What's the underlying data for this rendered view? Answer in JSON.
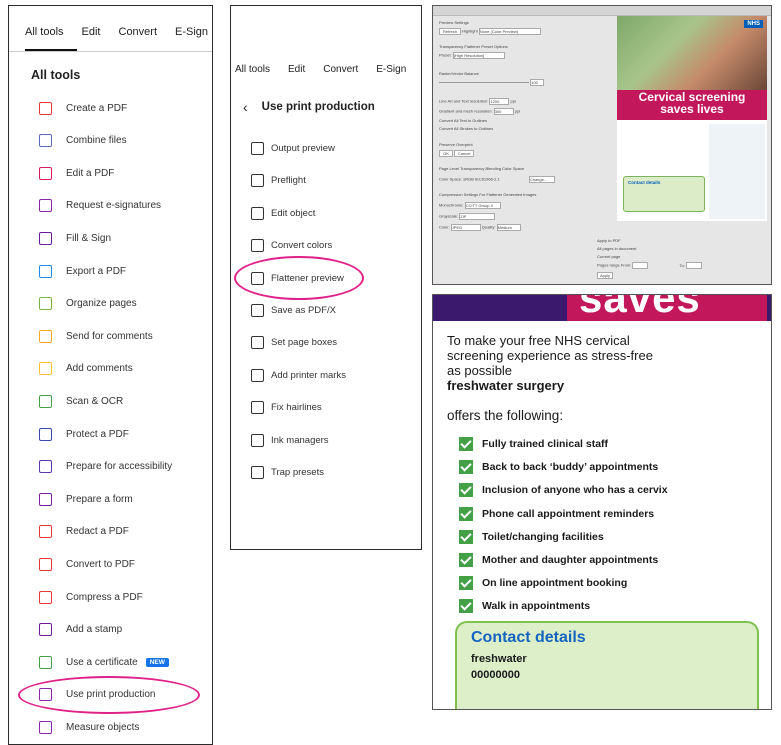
{
  "left_panel": {
    "tabs": [
      "All tools",
      "Edit",
      "Convert",
      "E-Sign"
    ],
    "title": "All tools",
    "tools": [
      {
        "label": "Create a PDF",
        "icon": "pdf-create-icon",
        "color": "#e53935"
      },
      {
        "label": "Combine files",
        "icon": "combine-files-icon",
        "color": "#5c6bc0"
      },
      {
        "label": "Edit a PDF",
        "icon": "edit-pdf-icon",
        "color": "#d81b60"
      },
      {
        "label": "Request e-signatures",
        "icon": "request-signature-icon",
        "color": "#8e24aa"
      },
      {
        "label": "Fill & Sign",
        "icon": "fill-sign-icon",
        "color": "#6a1b9a"
      },
      {
        "label": "Export a PDF",
        "icon": "export-pdf-icon",
        "color": "#1e88e5"
      },
      {
        "label": "Organize pages",
        "icon": "organize-pages-icon",
        "color": "#7cb342"
      },
      {
        "label": "Send for comments",
        "icon": "send-comments-icon",
        "color": "#f9a825"
      },
      {
        "label": "Add comments",
        "icon": "add-comments-icon",
        "color": "#fbc02d"
      },
      {
        "label": "Scan & OCR",
        "icon": "scan-ocr-icon",
        "color": "#43a047"
      },
      {
        "label": "Protect a PDF",
        "icon": "protect-pdf-icon",
        "color": "#3949ab"
      },
      {
        "label": "Prepare for accessibility",
        "icon": "accessibility-icon",
        "color": "#5e35b1"
      },
      {
        "label": "Prepare a form",
        "icon": "prepare-form-icon",
        "color": "#7b1fa2"
      },
      {
        "label": "Redact a PDF",
        "icon": "redact-icon",
        "color": "#e53935"
      },
      {
        "label": "Convert to PDF",
        "icon": "convert-pdf-icon",
        "color": "#e53935"
      },
      {
        "label": "Compress a PDF",
        "icon": "compress-pdf-icon",
        "color": "#e53935"
      },
      {
        "label": "Add a stamp",
        "icon": "stamp-icon",
        "color": "#6a1b9a"
      },
      {
        "label": "Use a certificate",
        "icon": "certificate-icon",
        "color": "#43a047",
        "badge": "NEW"
      },
      {
        "label": "Use print production",
        "icon": "print-production-icon",
        "color": "#8e24aa"
      },
      {
        "label": "Measure objects",
        "icon": "measure-icon",
        "color": "#8e24aa"
      }
    ]
  },
  "mid_panel": {
    "tabs": [
      "All tools",
      "Edit",
      "Convert",
      "E-Sign"
    ],
    "title": "Use print production",
    "items": [
      {
        "label": "Output preview",
        "icon": "output-preview-icon"
      },
      {
        "label": "Preflight",
        "icon": "preflight-icon"
      },
      {
        "label": "Edit object",
        "icon": "edit-object-icon"
      },
      {
        "label": "Convert colors",
        "icon": "convert-colors-icon"
      },
      {
        "label": "Flattener preview",
        "icon": "flattener-preview-icon"
      },
      {
        "label": "Save as PDF/X",
        "icon": "save-pdfx-icon"
      },
      {
        "label": "Set page boxes",
        "icon": "page-boxes-icon"
      },
      {
        "label": "Add printer marks",
        "icon": "printer-marks-icon"
      },
      {
        "label": "Fix hairlines",
        "icon": "hairlines-icon"
      },
      {
        "label": "Ink managers",
        "icon": "ink-managers-icon"
      },
      {
        "label": "Trap presets",
        "icon": "trap-presets-icon"
      }
    ]
  },
  "flattener_dialog": {
    "section_preview": "Preview Settings",
    "refresh": "Refresh",
    "highlight": "Highlight",
    "highlight_value": "None (Color Preview)",
    "section_preset": "Transparency Flattener Preset Options",
    "preset_label": "Preset:",
    "preset_value": "[High Resolution]",
    "balance_label": "Raster/Vector Balance",
    "balance_value": "100",
    "line_art_label": "Line Art and Text resolution:",
    "line_art_value": "1200",
    "gradient_label": "Gradient and mesh resolution:",
    "gradient_value": "300",
    "ppi": "ppi",
    "opt1": "Convert All Text to Outlines",
    "opt2": "Convert All Strokes to Outlines",
    "opt3": "Preserve Overprint",
    "ok": "OK",
    "cancel": "Cancel",
    "section_color": "Page Level Transparency Blending Color Space",
    "color_space_label": "Color Space:",
    "color_space_value": "sRGB IEC61966-2.1",
    "change": "Change...",
    "section_compress": "Compression Settings For Flattener Generated Images",
    "mono_label": "Monochrome:",
    "mono_value": "CCITT Group 4",
    "gray_label": "Grayscale:",
    "gray_value": "ZIP",
    "color_label": "Color:",
    "color_value": "JPEG",
    "quality_label": "Quality:",
    "quality_value": "Medium",
    "apply_title": "Apply to PDF",
    "apply_opt1": "All pages in document",
    "apply_opt2": "Current page",
    "apply_opt3": "Pages range",
    "from": "From:",
    "to": "To:",
    "apply_btn": "Apply"
  },
  "poster_thumb": {
    "nhs": "NHS",
    "headline1": "Cervical screening",
    "headline2": "saves lives",
    "contact": "Contact details"
  },
  "poster_zoom": {
    "saves": "saves",
    "intro_line1": "To make your free NHS cervical",
    "intro_line2": "screening experience as stress-free",
    "intro_line3": "as possible",
    "surgery": "freshwater surgery",
    "offers": "offers the following:",
    "checklist": [
      "Fully trained clinical staff",
      "Back to back ‘buddy’ appointments",
      "Inclusion of anyone who has a cervix",
      "Phone call appointment reminders",
      "Toilet/changing facilities",
      "Mother and daughter appointments",
      "On line appointment booking",
      "Walk in appointments"
    ],
    "contact_title": "Contact details",
    "contact_name": "freshwater",
    "contact_phone": "00000000"
  },
  "colors": {
    "highlight_ellipse": "#e0218a",
    "nhs_blue": "#005eb8",
    "poster_pink": "#c2185b",
    "check_green": "#43a047"
  }
}
